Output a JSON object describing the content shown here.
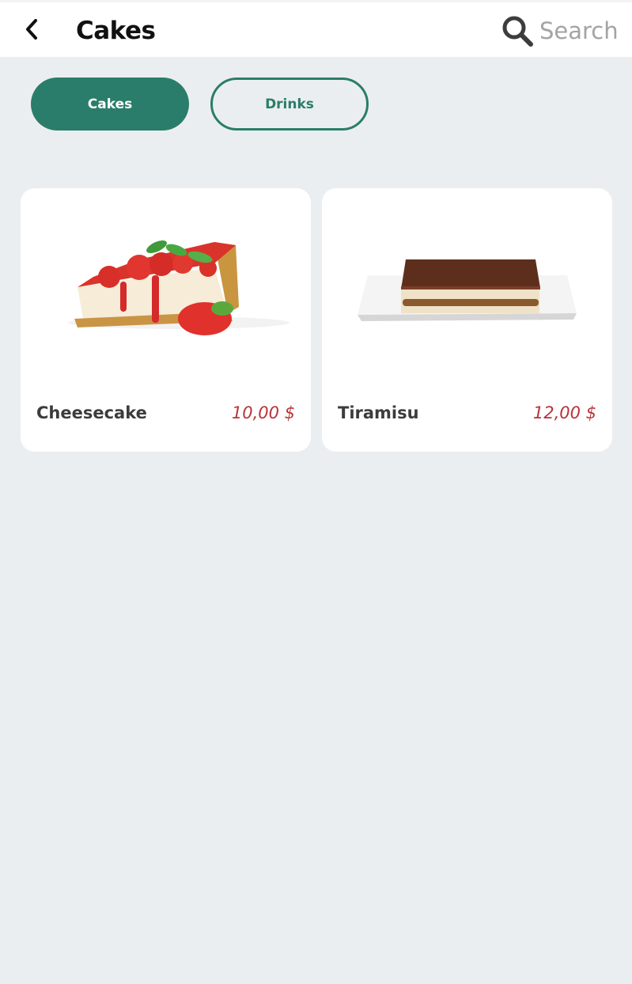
{
  "header": {
    "title": "Cakes",
    "back_icon": "chevron-left-icon",
    "search_icon": "search-icon",
    "search_placeholder": "Search"
  },
  "tabs": [
    {
      "label": "Cakes",
      "active": true
    },
    {
      "label": "Drinks",
      "active": false
    }
  ],
  "products": [
    {
      "name": "Cheesecake",
      "price": "10,00 $",
      "image": "strawberry-cheesecake-slice"
    },
    {
      "name": "Tiramisu",
      "price": "12,00 $",
      "image": "tiramisu-on-plate"
    }
  ],
  "colors": {
    "accent": "#2a7d6a",
    "price": "#b8343a",
    "background": "#ebeef0"
  }
}
